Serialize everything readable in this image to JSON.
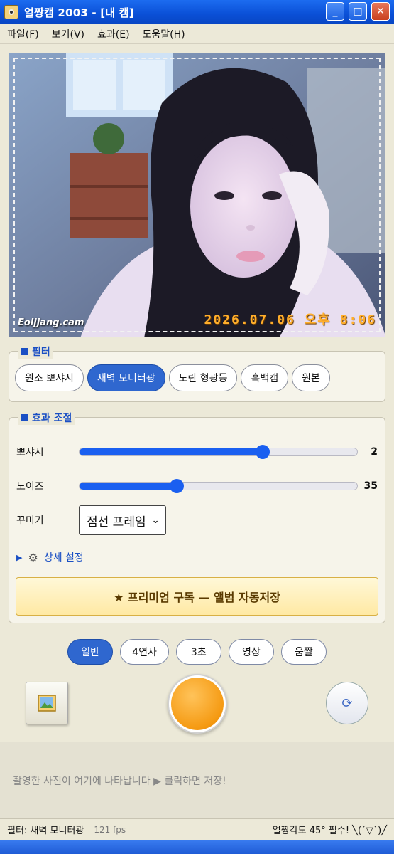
{
  "window": {
    "title": "얼짱캠 2003 - [내 캠]",
    "controls": {
      "minimize": "_",
      "maximize": "□",
      "close": "✕"
    },
    "app_icon": "camera-icon"
  },
  "menu": {
    "items": [
      "파일(F)",
      "보기(V)",
      "효과(E)",
      "도움말(H)"
    ]
  },
  "preview": {
    "watermark": "Eoljjang.cam",
    "timestamp": "2026.07.06 오후 8:06"
  },
  "filters": {
    "legend": "필터",
    "items": [
      "원조 뽀샤시",
      "새벽 모니터광",
      "노란 형광등",
      "흑백캠",
      "원본"
    ],
    "active_index": 1
  },
  "effects": {
    "legend": "효과 조절",
    "sliders": [
      {
        "label": "뽀샤시",
        "value": "2",
        "fraction": 0.66
      },
      {
        "label": "노이즈",
        "value": "35",
        "fraction": 0.35
      }
    ],
    "decor_label": "꾸미기",
    "decor_value": "점선 프레임",
    "advanced_label": "상세 설정",
    "premium_label": "★ 프리미엄 구독 — 앨범 자동저장"
  },
  "modes": {
    "items": [
      "일반",
      "4연사",
      "3초",
      "영상",
      "움짤"
    ],
    "active_index": 0
  },
  "buttons": {
    "gallery_icon": "picture-icon",
    "switch_icon": "camera-switch-icon",
    "switch_glyph": "⟳"
  },
  "strip": {
    "hint": "촬영한 사진이 여기에 나타납니다 ▶ 클릭하면 저장!"
  },
  "status": {
    "filter": "필터: 새벽 모니터광",
    "fps": "121 fps",
    "tip": "얼짱각도 45° 필수! ╲(´▽`)╱"
  },
  "colors": {
    "accent": "#2f67cf",
    "title_bar": "#0a4fd6",
    "timestamp": "#ffae2b",
    "slider": "#1a5ff0"
  }
}
